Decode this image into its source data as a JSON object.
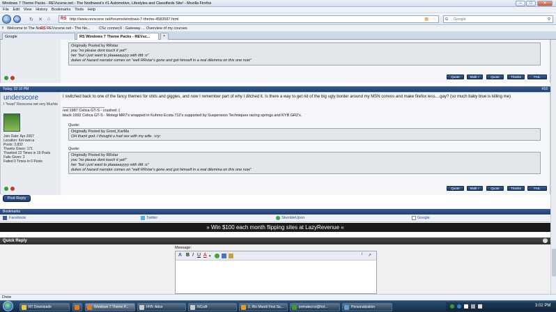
{
  "window": {
    "title": "Windows 7 Theme Packs - REVscene.net - The Northwest's #1 Automotive, Lifestyles and Classifieds Site! - Mozilla Firefox",
    "minimize": "–",
    "maximize": "□",
    "close": "✕"
  },
  "menu": [
    "File",
    "Edit",
    "View",
    "History",
    "Bookmarks",
    "Tools",
    "Help"
  ],
  "nav": {
    "url": "http://www.revscene.net/forums/windows-7-theme-4583587.html",
    "site_badge": "RS",
    "search_placeholder": "Google"
  },
  "bookmarks": [
    "Welcome to The No...",
    "REVscene.net - The No...",
    "CSc connecX : Gateway ...",
    "Overview of my courses"
  ],
  "tabs": [
    {
      "label": "Google",
      "active": false
    },
    {
      "label": "RS Windows 7 Theme Packs - REVsc...",
      "active": true
    },
    {
      "label": "+",
      "active": false
    }
  ],
  "top_post": {
    "quote_lines": [
      "Originally Posted by RRxtar",
      "you \"no please dont touch it yet!\"",
      "her \"but i just want to plaaaaayyyy with itttt :o\"",
      "dukes of hazard narrator comes on \"well RRxtar's gone and got himself in a real dilemma on this one now\""
    ],
    "buttons": [
      "Quote",
      "Multi +",
      "Quote",
      "Thanks",
      "FAIL"
    ]
  },
  "post": {
    "date": "Today, 02:10 PM",
    "number": "#16",
    "username": "underscore",
    "user_title": "I \"heart\" Revscene.net very Muchie",
    "join_date": "Join Date: Apr 2007",
    "location": "Location: Kel-own-a",
    "posts": "Posts: 3,832",
    "thanks_given": "Thanks Given: 171",
    "thanked": "Thanked 22 Times in 19 Posts",
    "fails_given": "Fails Given: 2",
    "failed": "Failed 0 Times in 0 Posts",
    "body": "I switched back to one of the fancy themes for shits and giggles, and now I remember part of why I ditched it. Is there a way to get rid of the big ugly border around my MSN convos and make firefox less....gay? (so much baby blue is killing me)",
    "sig_line1": "red 1987 Celica GT-S - crushed :(",
    "sig_line2": "black 1992 Celica GT-S - Motegi MR7's wrapped in Kuhmo Ecsta 712's supported by Suspension Techniques racing springs and KYB GR2's.",
    "quote_label": "Quote:",
    "quote1_author": "Originally Posted by Good_KarMa",
    "quote1_text": "OH thank god. I thought u had sex with my wife. :cry:",
    "quote2_author": "Originally Posted by RRxtar",
    "quote2_l1": "you \"no please dont touch it yet!\"",
    "quote2_l2": "her \"but i just want to plaaaaayyyy with itttt :o\"",
    "quote2_l3": "dukes of hazard narrator comes on \"well RRxtar's gone and got himself in a real dilemma on this one now\"",
    "buttons": [
      "Quote",
      "Multi +",
      "Quote",
      "Thanks",
      "FAIL"
    ]
  },
  "post_reply": "Post Reply",
  "bookmarks_section": {
    "title": "Bookmarks",
    "links": [
      "Facebook",
      "Twitter",
      "StumbleUpon",
      "Google"
    ]
  },
  "ad": "» Win $100 each month flipping sites at LazyRevenue «",
  "quick_reply": {
    "title": "Quick Reply",
    "message_label": "Message:"
  },
  "status": "Done",
  "taskbar": {
    "items": [
      "RT Downloads",
      "Windows 7 Theme P...",
      "FFB: Ados",
      "NCraft",
      "2. Rio Mundi Fest Su...",
      "primatecrur@hot...",
      "Personalization"
    ],
    "clock": "3:02 PM"
  },
  "colors": {
    "header_blue": "#1f3e70",
    "link_blue": "#1b4c9e",
    "quote_bg": "#e2e6ea"
  }
}
